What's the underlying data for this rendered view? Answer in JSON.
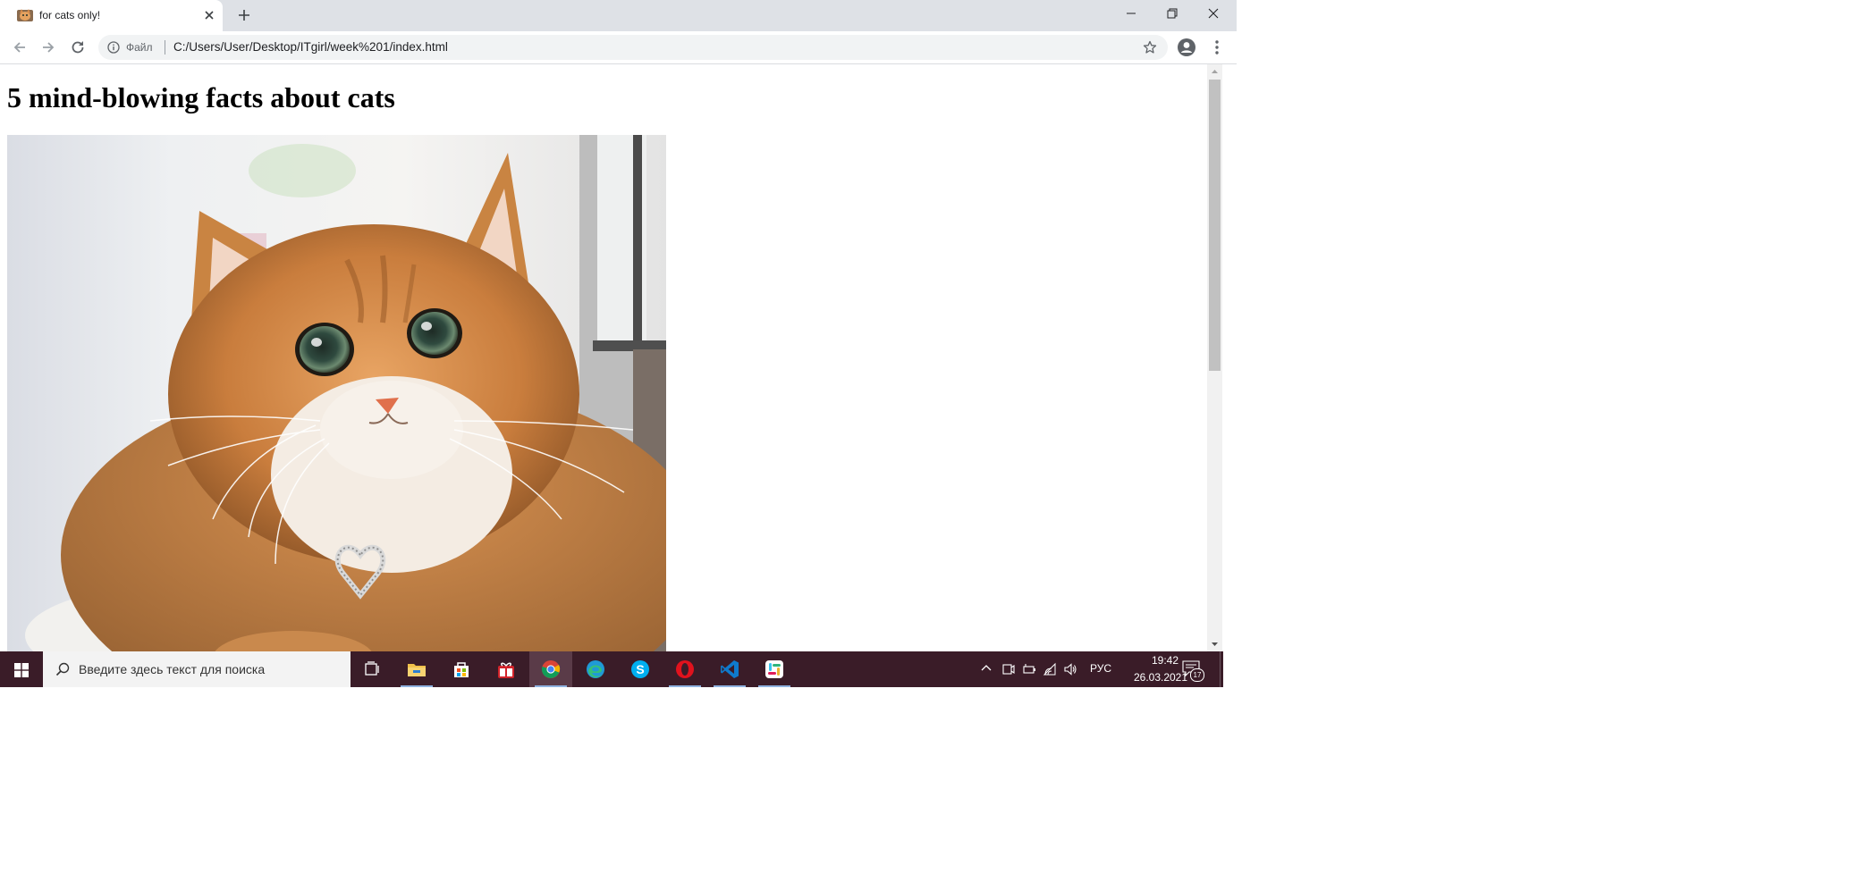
{
  "browser": {
    "tab": {
      "title": "for cats only!",
      "favicon": "cat-favicon"
    },
    "address_bar": {
      "scheme_label": "Файл",
      "url": "C:/Users/User/Desktop/ITgirl/week%201/index.html"
    },
    "icons": [
      "back-arrow-icon",
      "forward-arrow-icon",
      "reload-icon",
      "info-icon",
      "star-icon",
      "profile-icon",
      "menu-icon"
    ]
  },
  "page": {
    "heading": "5 mind-blowing facts about cats",
    "image": "cat-photo"
  },
  "taskbar": {
    "search_placeholder": "Введите здесь текст для поиска",
    "apps": [
      "task-view",
      "file-explorer",
      "microsoft-store",
      "gift-app",
      "chrome",
      "edge",
      "skype",
      "opera",
      "vscode",
      "slack"
    ],
    "active_app": "chrome",
    "language": "РУС",
    "time": "19:42",
    "date": "26.03.2021",
    "notification_count": "17"
  },
  "colors": {
    "tab_strip": "#dee1e6",
    "omnibox": "#f1f3f4",
    "taskbar": "#3a1c28",
    "accent_running": "#8fb2e0"
  }
}
